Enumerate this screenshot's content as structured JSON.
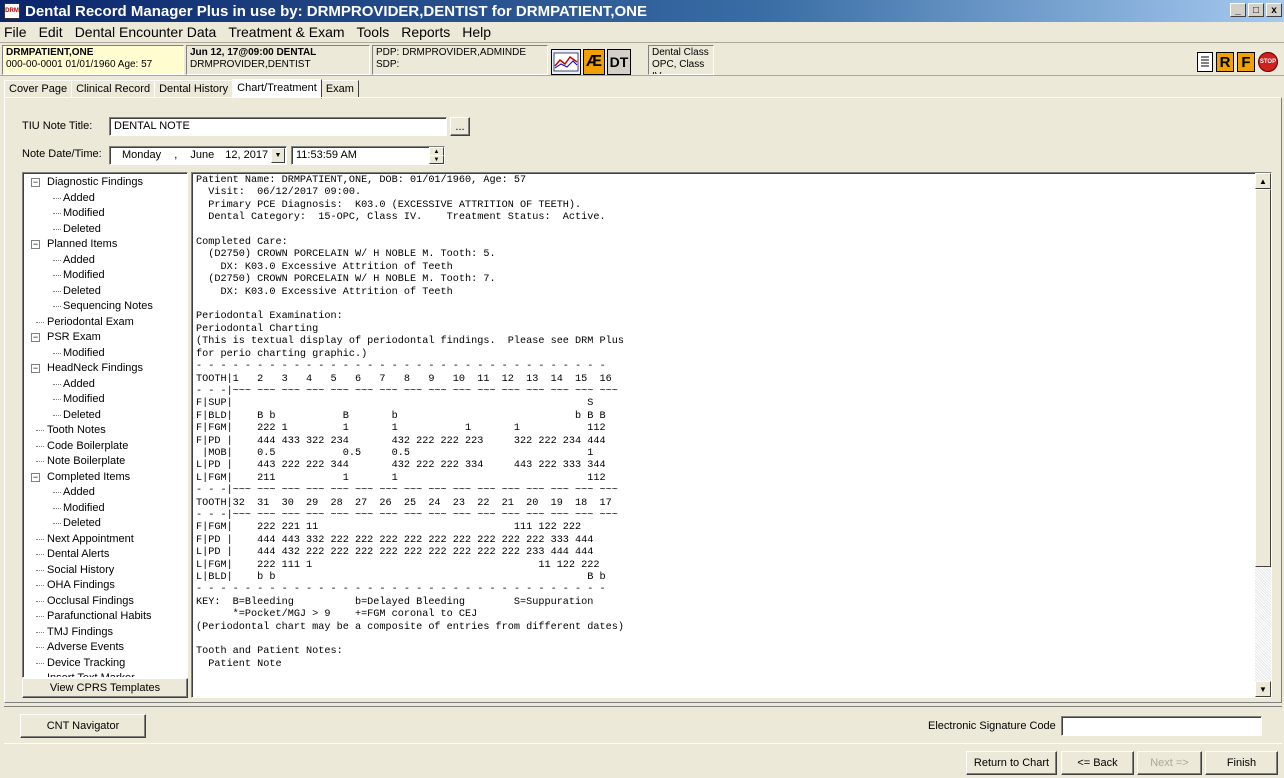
{
  "window": {
    "title": "Dental Record Manager Plus in use by: DRMPROVIDER,DENTIST for DRMPATIENT,ONE",
    "app_icon_text": "DRM",
    "min": "_",
    "max": "□",
    "close": "x"
  },
  "menu": [
    "File",
    "Edit",
    "Dental Encounter Data",
    "Treatment & Exam",
    "Tools",
    "Reports",
    "Help"
  ],
  "patient_bar": {
    "patient_name": "DRMPATIENT,ONE",
    "patient_id_line": "000-00-0001   01/01/1960 Age:  57",
    "visit_line1": "Jun 12, 17@09:00 DENTAL",
    "visit_line2": "DRMPROVIDER,DENTIST",
    "pdp": "PDP: DRMPROVIDER,ADMINDE",
    "sdp": "SDP:",
    "ae_label": "Æ",
    "dt_label": "DT",
    "dental_class_line1": "Dental Class",
    "dental_class_line2": "OPC, Class IV",
    "r_label": "R",
    "f_label": "F",
    "stop_label": "STOP"
  },
  "tabs": [
    "Cover Page",
    "Clinical Record",
    "Dental History",
    "Chart/Treatment",
    "Exam"
  ],
  "active_tab": "Chart/Treatment",
  "tiu": {
    "label": "TIU Note Title:",
    "value": "DENTAL NOTE",
    "browse": "..."
  },
  "note_date": {
    "label": "Note Date/Time:",
    "day": "Monday",
    "sep": ",",
    "month": "June",
    "date": "12, 2017",
    "time": "11:53:59 AM"
  },
  "tree": [
    {
      "label": "Diagnostic Findings",
      "level": 0,
      "toggle": "−"
    },
    {
      "label": "Added",
      "level": 1
    },
    {
      "label": "Modified",
      "level": 1
    },
    {
      "label": "Deleted",
      "level": 1
    },
    {
      "label": "Planned Items",
      "level": 0,
      "toggle": "−"
    },
    {
      "label": "Added",
      "level": 1
    },
    {
      "label": "Modified",
      "level": 1
    },
    {
      "label": "Deleted",
      "level": 1
    },
    {
      "label": "Sequencing Notes",
      "level": 1
    },
    {
      "label": "Periodontal Exam",
      "level": 0
    },
    {
      "label": "PSR Exam",
      "level": 0,
      "toggle": "−"
    },
    {
      "label": "Modified",
      "level": 1
    },
    {
      "label": "HeadNeck Findings",
      "level": 0,
      "toggle": "−"
    },
    {
      "label": "Added",
      "level": 1
    },
    {
      "label": "Modified",
      "level": 1
    },
    {
      "label": "Deleted",
      "level": 1
    },
    {
      "label": "Tooth Notes",
      "level": 0
    },
    {
      "label": "Code Boilerplate",
      "level": 0
    },
    {
      "label": "Note Boilerplate",
      "level": 0
    },
    {
      "label": "Completed Items",
      "level": 0,
      "toggle": "−"
    },
    {
      "label": "Added",
      "level": 1
    },
    {
      "label": "Modified",
      "level": 1
    },
    {
      "label": "Deleted",
      "level": 1
    },
    {
      "label": "Next Appointment",
      "level": 0
    },
    {
      "label": "Dental Alerts",
      "level": 0
    },
    {
      "label": "Social History",
      "level": 0
    },
    {
      "label": "OHA Findings",
      "level": 0
    },
    {
      "label": "Occlusal Findings",
      "level": 0
    },
    {
      "label": "Parafunctional Habits",
      "level": 0
    },
    {
      "label": "TMJ Findings",
      "level": 0
    },
    {
      "label": "Adverse Events",
      "level": 0
    },
    {
      "label": "Device Tracking",
      "level": 0
    },
    {
      "label": "Insert Text Marker",
      "level": 0
    }
  ],
  "view_cprs_button": "View CPRS Templates",
  "note_text": "Patient Name: DRMPATIENT,ONE, DOB: 01/01/1960, Age: 57\n  Visit:  06/12/2017 09:00.\n  Primary PCE Diagnosis:  K03.0 (EXCESSIVE ATTRITION OF TEETH).\n  Dental Category:  15-OPC, Class IV.    Treatment Status:  Active.\n\nCompleted Care:\n  (D2750) CROWN PORCELAIN W/ H NOBLE M. Tooth: 5.\n    DX: K03.0 Excessive Attrition of Teeth\n  (D2750) CROWN PORCELAIN W/ H NOBLE M. Tooth: 7.\n    DX: K03.0 Excessive Attrition of Teeth\n\nPeriodontal Examination:\nPeriodontal Charting\n(This is textual display of periodontal findings.  Please see DRM Plus\nfor perio charting graphic.)\n- - - - - - - - - - - - - - - - - - - - - - - - - - - - - - - - - -\nTOOTH|1   2   3   4   5   6   7   8   9   10  11  12  13  14  15  16\n- - -|~~~ ~~~ ~~~ ~~~ ~~~ ~~~ ~~~ ~~~ ~~~ ~~~ ~~~ ~~~ ~~~ ~~~ ~~~ ~~~\nF|SUP|                                                          S\nF|BLD|    B b           B       b                             b B B\nF|FGM|    222 1         1       1           1       1           112\nF|PD |    444 433 322 234       432 222 222 223     322 222 234 444\n |MOB|    0.5           0.5     0.5                             1\nL|PD |    443 222 222 344       432 222 222 334     443 222 333 344\nL|FGM|    211           1       1                               112\n- - -|~~~ ~~~ ~~~ ~~~ ~~~ ~~~ ~~~ ~~~ ~~~ ~~~ ~~~ ~~~ ~~~ ~~~ ~~~ ~~~\nTOOTH|32  31  30  29  28  27  26  25  24  23  22  21  20  19  18  17\n- - -|~~~ ~~~ ~~~ ~~~ ~~~ ~~~ ~~~ ~~~ ~~~ ~~~ ~~~ ~~~ ~~~ ~~~ ~~~ ~~~\nF|FGM|    222 221 11                                111 122 222\nF|PD |    444 443 332 222 222 222 222 222 222 222 222 222 333 444\nL|PD |    444 432 222 222 222 222 222 222 222 222 222 233 444 444\nL|FGM|    222 111 1                                     11 122 222\nL|BLD|    b b                                                   B b\n- - - - - - - - - - - - - - - - - - - - - - - - - - - - - - - - - -\nKEY:  B=Bleeding          b=Delayed Bleeding        S=Suppuration\n      *=Pocket/MGJ > 9    +=FGM coronal to CEJ\n(Periodontal chart may be a composite of entries from different dates)\n\nTooth and Patient Notes:\n  Patient Note",
  "cnt_button": "CNT Navigator",
  "esig_label": "Electronic Signature Code",
  "esig_value": "",
  "nav": {
    "return": "Return to Chart",
    "back": "<= Back",
    "next": "Next =>",
    "finish": "Finish"
  }
}
